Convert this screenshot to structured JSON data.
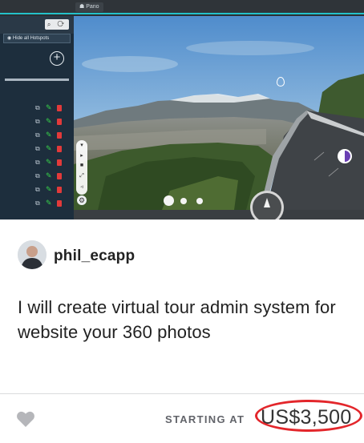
{
  "thumbnail": {
    "panorama_tab": "☗ Pano",
    "hide_hotspots": "◉ Hide all Hotspots",
    "search_glyphs": "⌕ ⟳",
    "add_glyph": "+",
    "pager": {
      "dot_count": 3,
      "active_index": 0
    }
  },
  "seller": {
    "name": "phil_ecapp"
  },
  "gig": {
    "title": "I will create virtual tour admin system for website your 360 photos"
  },
  "footer": {
    "starting_at_label": "STARTING AT",
    "price": "US$3,500",
    "favorite_icon": "heart-icon"
  },
  "colors": {
    "accent_teal": "#24c1c9",
    "highlight_red": "#e3262b",
    "heart_gray": "#b5b6ba",
    "label_gray": "#62646a"
  }
}
